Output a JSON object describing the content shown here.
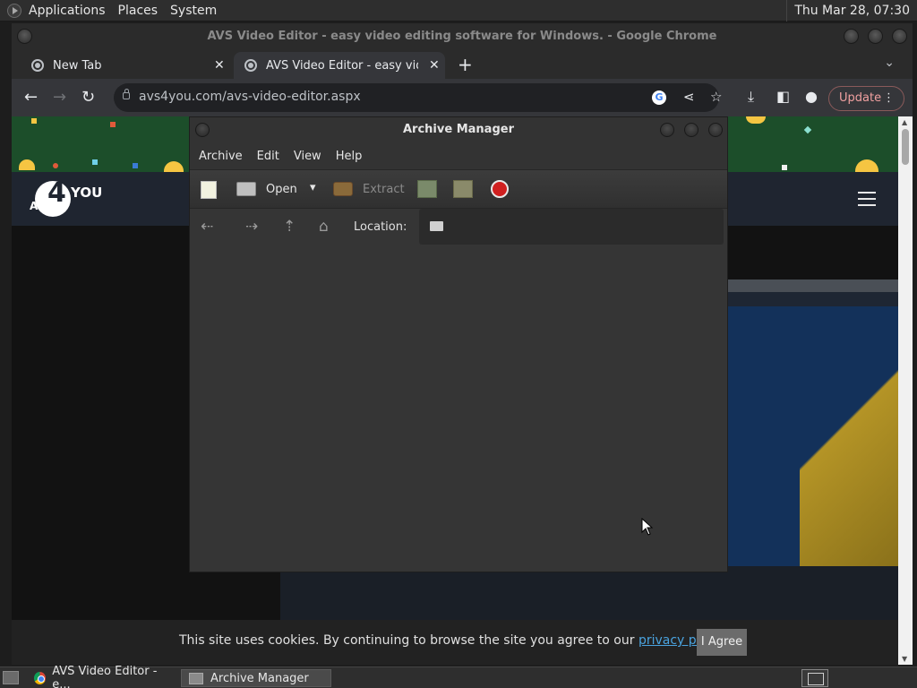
{
  "top_panel": {
    "menus": [
      "Applications",
      "Places",
      "System"
    ],
    "clock": "Thu Mar 28, 07:30"
  },
  "chrome": {
    "window_title": "AVS Video Editor - easy video editing software for Windows. - Google Chrome",
    "tabs": [
      {
        "label": "New Tab"
      },
      {
        "label": "AVS Video Editor - easy video"
      }
    ],
    "new_tab_symbol": "+",
    "url": "avs4you.com/avs-video-editor.aspx",
    "update_label": "Update"
  },
  "page": {
    "logo_four": "4",
    "logo_you": "YOU",
    "logo_avs": "AVS",
    "cookie_text": "This site uses cookies. By continuing to browse the site you agree to our ",
    "cookie_link": "privacy policy",
    "cookie_end": ".",
    "agree_label": "I Agree"
  },
  "archive_manager": {
    "title": "Archive Manager",
    "menus": [
      "Archive",
      "Edit",
      "View",
      "Help"
    ],
    "toolbar": {
      "open_label": "Open",
      "extract_label": "Extract"
    },
    "location_label": "Location:"
  },
  "taskbar": {
    "tasks": [
      {
        "label": "AVS Video Editor - e..."
      },
      {
        "label": "Archive Manager"
      }
    ]
  },
  "colors": {
    "banner_green": "#1c4e2a",
    "header_navy": "#1f2530",
    "link_blue": "#4aa3df",
    "update_border": "#8a5a5a",
    "stop_red": "#d02020"
  }
}
